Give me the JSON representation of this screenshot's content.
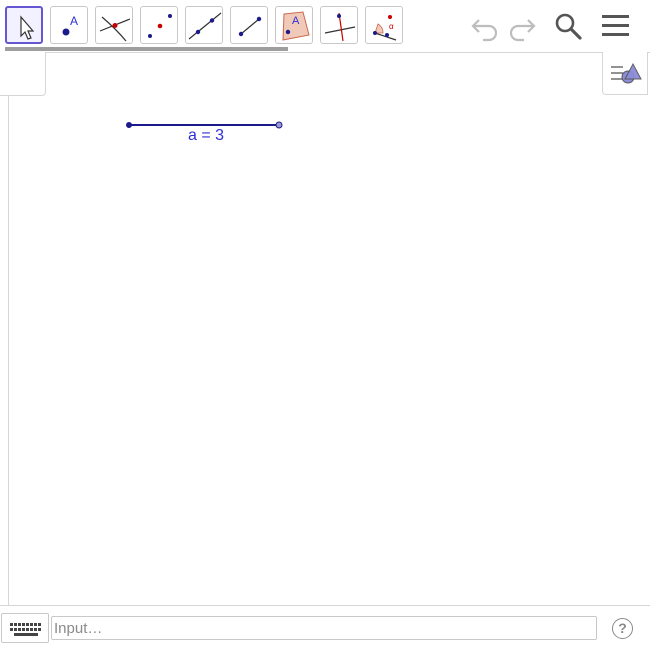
{
  "toolbar": {
    "tools": [
      {
        "name": "move-tool",
        "icon": "move-arrow-icon",
        "selected": true
      },
      {
        "name": "point-tool",
        "icon": "point-icon",
        "label": "A"
      },
      {
        "name": "intersect-tool",
        "icon": "intersect-icon"
      },
      {
        "name": "midpoint-tool",
        "icon": "midpoint-icon"
      },
      {
        "name": "line-tool",
        "icon": "line-icon"
      },
      {
        "name": "segment-tool",
        "icon": "segment-icon"
      },
      {
        "name": "polygon-tool",
        "icon": "polygon-icon",
        "label": "A"
      },
      {
        "name": "perpendicular-tool",
        "icon": "perpendicular-icon"
      },
      {
        "name": "angle-tool",
        "icon": "angle-icon",
        "label": "α"
      }
    ],
    "undo_icon": "undo-icon",
    "redo_icon": "redo-icon",
    "search_icon": "search-icon",
    "menu_icon": "hamburger-menu-icon"
  },
  "style_bar": {
    "icon": "style-bar-toggle-icon"
  },
  "graphics": {
    "segment": {
      "name": "a",
      "length": 3,
      "label": "a = 3",
      "color": "#1a1a8c"
    }
  },
  "input_bar": {
    "keyboard_icon": "keyboard-icon",
    "placeholder": "Input…",
    "help_label": "?"
  },
  "colors": {
    "accent": "#6557d2",
    "object_blue": "#3030d0",
    "point_blue": "#1a1a8c",
    "point_red": "#cc0000",
    "border": "#c8c8c8"
  }
}
